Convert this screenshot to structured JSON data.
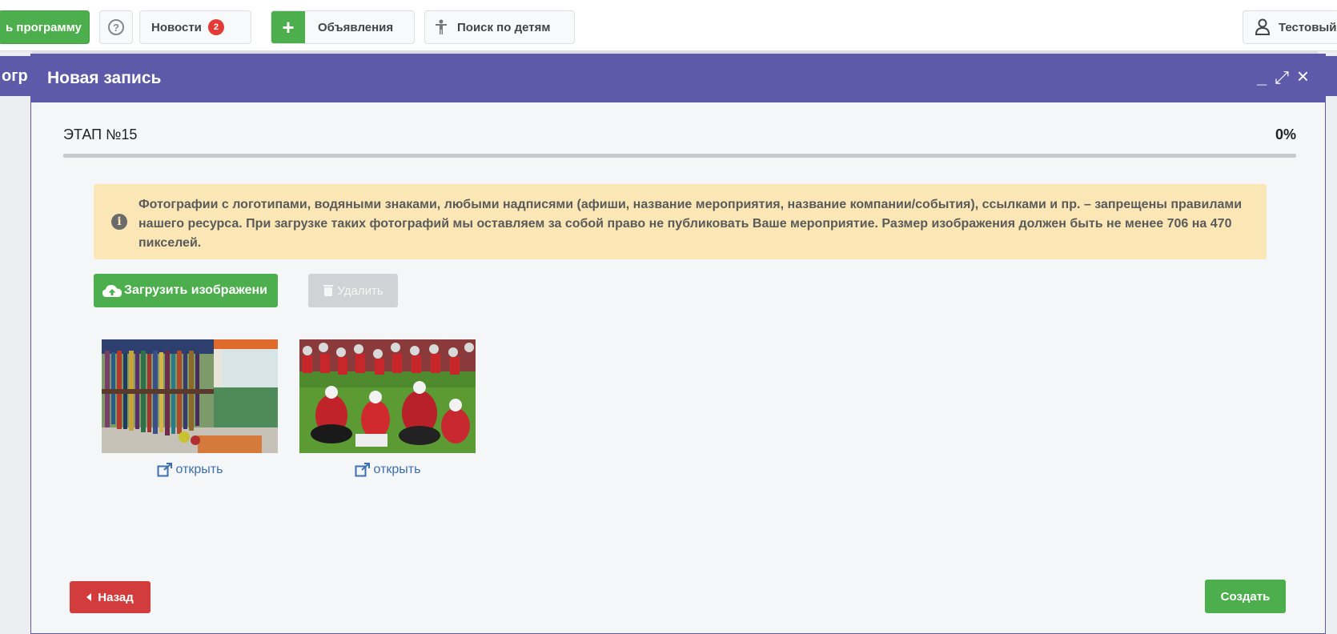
{
  "topbar": {
    "program_button": "ь программу",
    "help_icon": "?",
    "news_label": "Новости",
    "news_badge": "2",
    "plus_label": "+",
    "ads_label": "Объявления",
    "child_search_label": "Поиск по детям",
    "user_label": "Тестовый"
  },
  "background": {
    "left_header_fragment": "огр"
  },
  "modal": {
    "title": "Новая запись",
    "controls": {
      "minimize": "_",
      "expand": "⤢",
      "close": "×"
    },
    "stage_label": "ЭТАП №15",
    "progress_text": "0%",
    "progress_value": 0,
    "alert_text": "Фотографии с логотипами, водяными знаками, любыми надписями (афиши, название мероприятия, название компании/события), ссылками и пр. – запрещены правилами нашего ресурса. При загрузке таких фотографий мы оставляем за собой право не публиковать Ваше мероприятие. Размер изображения должен быть не менее 706 на 470 пикселей.",
    "upload_button": "Загрузить изображени",
    "delete_button": "Удалить",
    "images": [
      {
        "open_label": "открыть"
      },
      {
        "open_label": "открыть"
      }
    ],
    "back_button": "Назад",
    "create_button": "Создать"
  },
  "colors": {
    "header": "#5d5aaa",
    "green": "#4cae4c",
    "red": "#d33c3c",
    "alert_bg": "#fbe7b6",
    "link": "#3a6fb0"
  }
}
